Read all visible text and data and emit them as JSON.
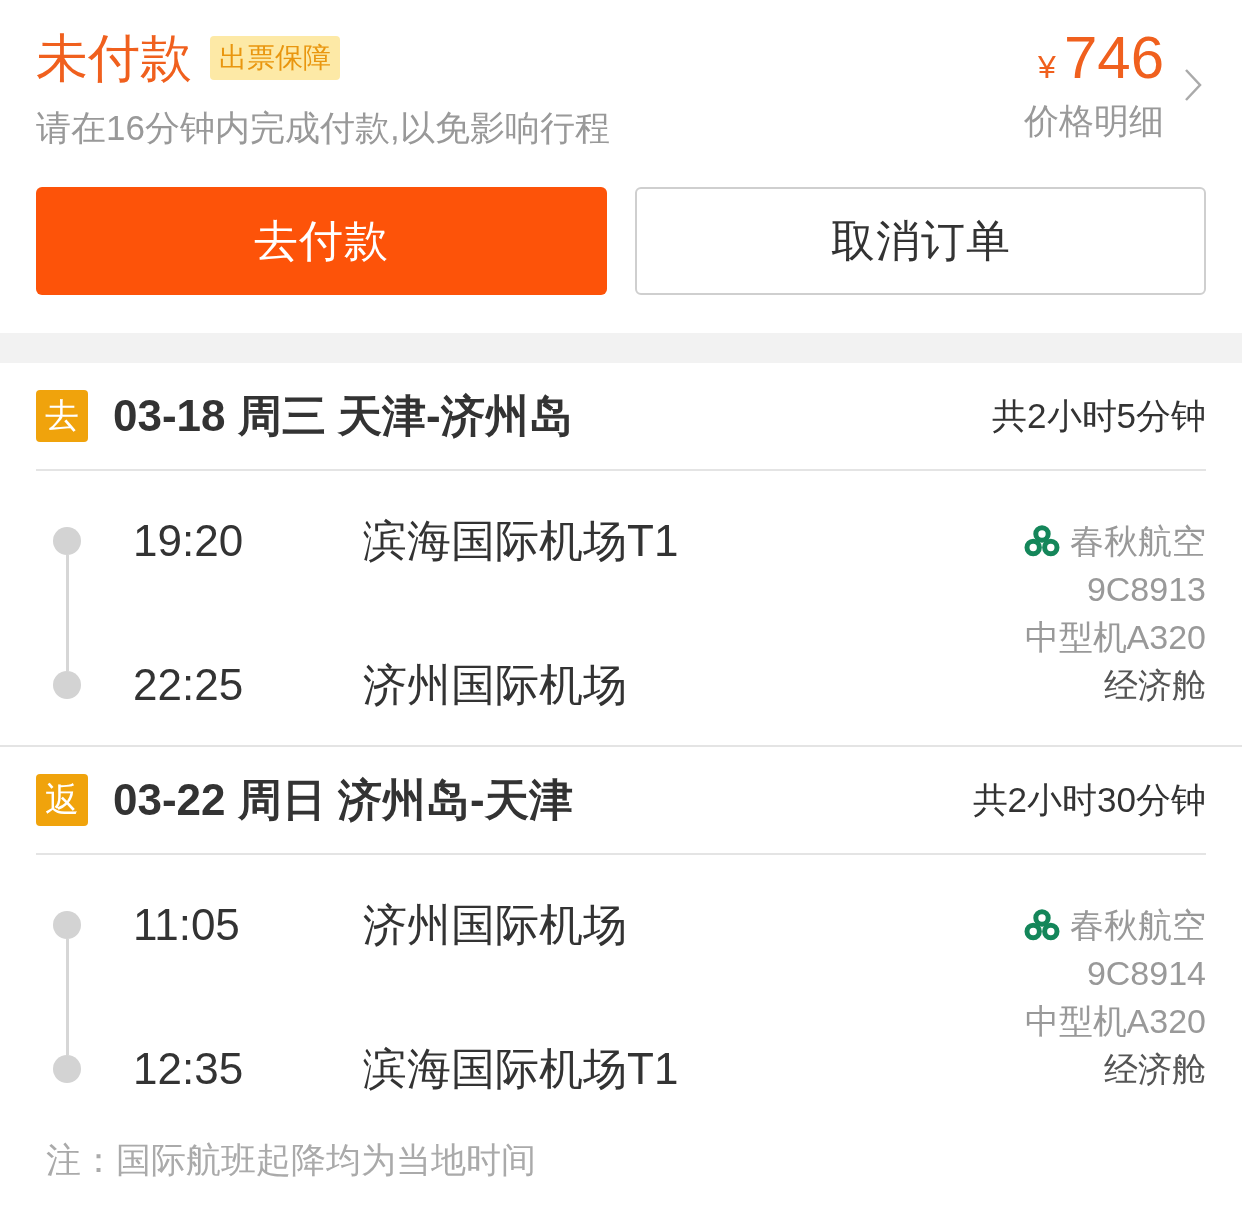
{
  "order": {
    "status": "未付款",
    "badge": "出票保障",
    "notice": "请在16分钟内完成付款,以免影响行程",
    "currency": "¥",
    "amount": "746",
    "price_detail": "价格明细"
  },
  "actions": [
    {
      "label": "去付款",
      "kind": "primary"
    },
    {
      "label": "取消订单",
      "kind": "secondary"
    }
  ],
  "legs": [
    {
      "tag": "去",
      "title": "03-18 周三 天津-济州岛",
      "duration": "共2小时5分钟",
      "departure": {
        "time": "19:20",
        "airport": "滨海国际机场T1"
      },
      "arrival": {
        "time": "22:25",
        "airport": "济州国际机场"
      },
      "airline": "春秋航空",
      "flight_no": "9C8913",
      "aircraft": "中型机A320",
      "cabin": "经济舱"
    },
    {
      "tag": "返",
      "title": "03-22 周日 济州岛-天津",
      "duration": "共2小时30分钟",
      "departure": {
        "time": "11:05",
        "airport": "济州国际机场"
      },
      "arrival": {
        "time": "12:35",
        "airport": "滨海国际机场T1"
      },
      "airline": "春秋航空",
      "flight_no": "9C8914",
      "aircraft": "中型机A320",
      "cabin": "经济舱"
    }
  ],
  "note": "注：国际航班起降均为当地时间"
}
